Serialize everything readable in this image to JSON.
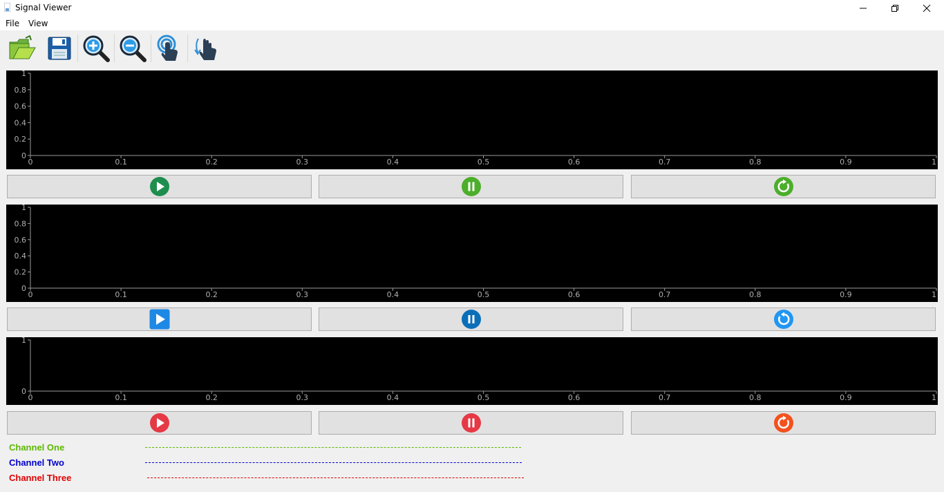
{
  "window": {
    "title": "Signal Viewer"
  },
  "menu": {
    "items": [
      "File",
      "View"
    ]
  },
  "toolbar": {
    "buttons": [
      "open-folder-icon",
      "save-icon",
      "zoom-in-icon",
      "zoom-out-icon",
      "touch-pointer-icon",
      "pan-hand-icon"
    ]
  },
  "plots": [
    {
      "y_ticks": [
        "0",
        "0.2",
        "0.4",
        "0.6",
        "0.8",
        "1"
      ],
      "x_ticks": [
        "0",
        "0.1",
        "0.2",
        "0.3",
        "0.4",
        "0.5",
        "0.6",
        "0.7",
        "0.8",
        "0.9",
        "1"
      ]
    },
    {
      "y_ticks": [
        "0",
        "0.2",
        "0.4",
        "0.6",
        "0.8",
        "1"
      ],
      "x_ticks": [
        "0",
        "0.1",
        "0.2",
        "0.3",
        "0.4",
        "0.5",
        "0.6",
        "0.7",
        "0.8",
        "0.9",
        "1"
      ]
    },
    {
      "y_ticks": [
        "0",
        "1"
      ],
      "x_ticks": [
        "0",
        "0.1",
        "0.2",
        "0.3",
        "0.4",
        "0.5",
        "0.6",
        "0.7",
        "0.8",
        "0.9",
        "1"
      ]
    }
  ],
  "controls": [
    {
      "play_color": "#1e8e4e",
      "pause_color": "#4cae2a",
      "reset_color": "#4cae2a"
    },
    {
      "play_color": "#1e88e5",
      "pause_color": "#0b6fb8",
      "reset_color": "#2196f3"
    },
    {
      "play_color": "#e53945",
      "pause_color": "#e53945",
      "reset_color": "#f4511e"
    }
  ],
  "legend": [
    {
      "label": "Channel One",
      "color": "#5cb800"
    },
    {
      "label": "Channel Two",
      "color": "#0000cc"
    },
    {
      "label": "Channel Three",
      "color": "#e00000"
    }
  ]
}
